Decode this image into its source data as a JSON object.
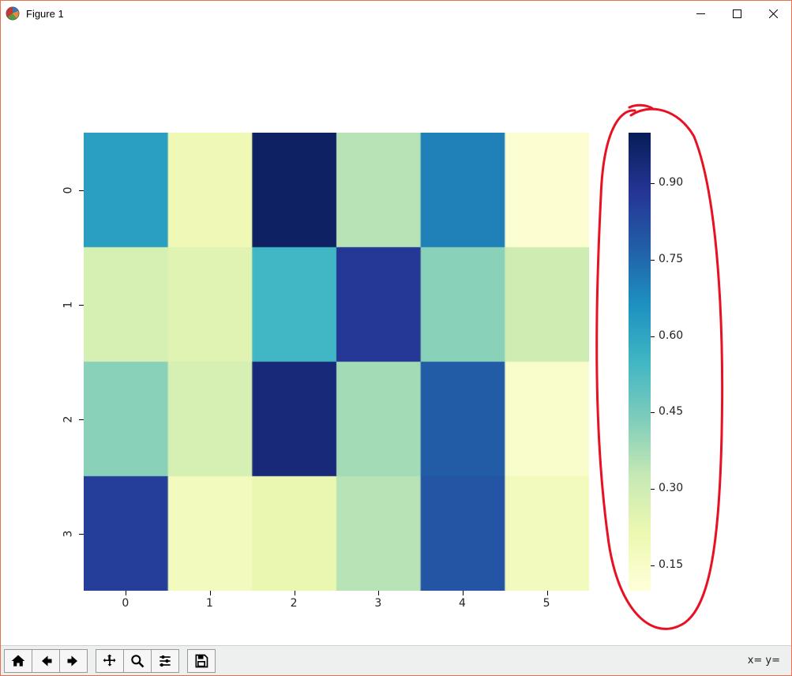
{
  "window": {
    "title": "Figure 1"
  },
  "status": {
    "text": "x= y="
  },
  "toolbar": {
    "home": "Home",
    "back": "Back",
    "forward": "Forward",
    "pan": "Pan",
    "zoom": "Zoom",
    "subplots": "Configure subplots",
    "save": "Save"
  },
  "chart_data": {
    "type": "heatmap",
    "x_categories": [
      "0",
      "1",
      "2",
      "3",
      "4",
      "5"
    ],
    "y_categories": [
      "0",
      "1",
      "2",
      "3"
    ],
    "values": [
      [
        0.62,
        0.2,
        0.98,
        0.35,
        0.7,
        0.12
      ],
      [
        0.28,
        0.25,
        0.55,
        0.88,
        0.42,
        0.3
      ],
      [
        0.42,
        0.28,
        0.94,
        0.38,
        0.78,
        0.14
      ],
      [
        0.86,
        0.18,
        0.22,
        0.35,
        0.8,
        0.18
      ]
    ],
    "colormap": "YlGnBu",
    "vmin": 0.1,
    "vmax": 1.0,
    "colorbar": {
      "ticks": [
        "0.15",
        "0.30",
        "0.45",
        "0.60",
        "0.75",
        "0.90"
      ]
    }
  }
}
